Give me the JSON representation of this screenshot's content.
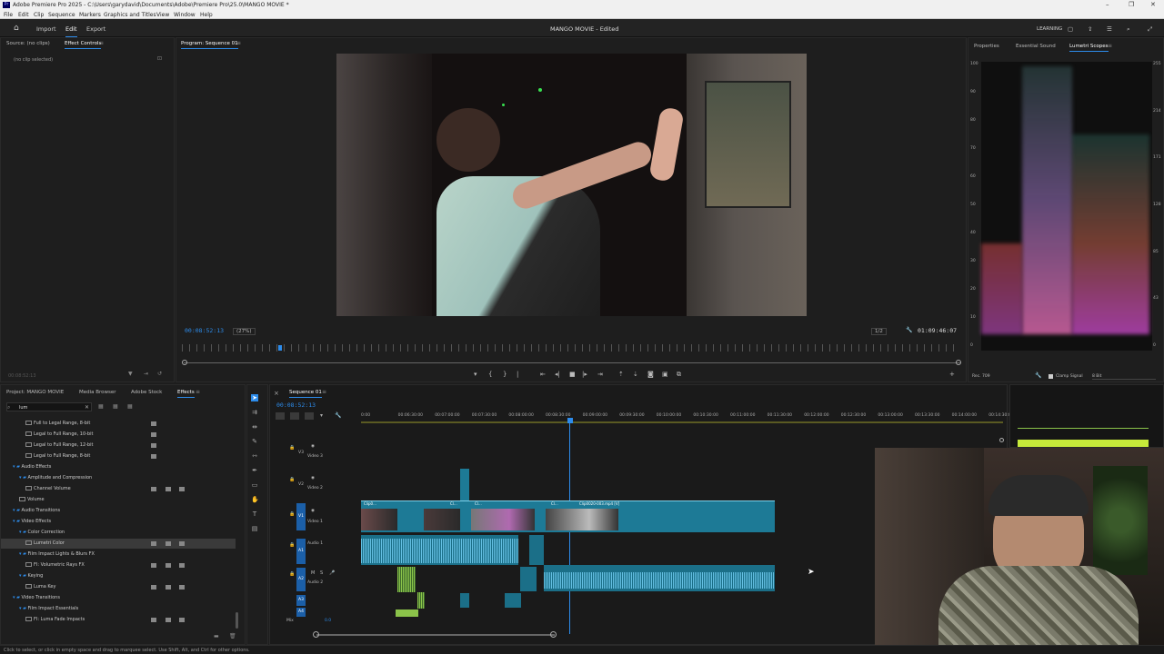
{
  "titlebar": {
    "title": "Adobe Premiere Pro 2025 - C:\\Users\\garydavid\\Documents\\Adobe\\Premiere Pro\\25.0\\MANGO MOVIE *"
  },
  "menu": [
    "File",
    "Edit",
    "Clip",
    "Sequence",
    "Markers",
    "Graphics and Titles",
    "View",
    "Window",
    "Help"
  ],
  "header": {
    "workspaces": [
      "Import",
      "Edit",
      "Export"
    ],
    "active": "Edit",
    "project_title": "MANGO MOVIE - Edited",
    "learning": "LEARNING"
  },
  "source_panel": {
    "tabs": [
      "Source: (no clips)",
      "Effect Controls"
    ],
    "active": "Effect Controls",
    "empty": "(no clip selected)",
    "timecode": "00:08:52:13"
  },
  "program": {
    "tab": "Program: Sequence 01",
    "timecode": "00:08:52:13",
    "zoom": "(27%)",
    "resolution": "1/2",
    "duration": "01:09:46:07",
    "playhead_fraction": 0.1
  },
  "scopes": {
    "tabs": [
      "Properties",
      "Essential Sound",
      "Lumetri Scopes"
    ],
    "active": "Lumetri Scopes",
    "left_scale": [
      "100",
      "90",
      "80",
      "70",
      "60",
      "50",
      "40",
      "30",
      "20",
      "10",
      "0"
    ],
    "right_scale": [
      "255",
      "214",
      "171",
      "128",
      "85",
      "43",
      "0"
    ],
    "colorspace": "Rec. 709",
    "clamp": "Clamp Signal",
    "bitdepth": "8 Bit"
  },
  "project_panel": {
    "tabs": [
      "Project: MANGO MOVIE",
      "Media Browser",
      "Adobe Stock",
      "Effects"
    ],
    "active": "Effects",
    "search": "lum",
    "tree": [
      {
        "label": "Full to Legal Range, 8-bit",
        "depth": 3,
        "type": "effect"
      },
      {
        "label": "Legal to Full Range, 10-bit",
        "depth": 3,
        "type": "effect"
      },
      {
        "label": "Legal to Full Range, 12-bit",
        "depth": 3,
        "type": "effect"
      },
      {
        "label": "Legal to Full Range, 8-bit",
        "depth": 3,
        "type": "effect"
      },
      {
        "label": "Audio Effects",
        "depth": 1,
        "type": "folder"
      },
      {
        "label": "Amplitude and Compression",
        "depth": 2,
        "type": "folder"
      },
      {
        "label": "Channel Volume",
        "depth": 3,
        "type": "effect"
      },
      {
        "label": "Volume",
        "depth": 2,
        "type": "effect"
      },
      {
        "label": "Audio Transitions",
        "depth": 1,
        "type": "folder"
      },
      {
        "label": "Video Effects",
        "depth": 1,
        "type": "folder"
      },
      {
        "label": "Color Correction",
        "depth": 2,
        "type": "folder"
      },
      {
        "label": "Lumetri Color",
        "depth": 3,
        "type": "effect",
        "selected": true
      },
      {
        "label": "Film Impact Lights & Blurs FX",
        "depth": 2,
        "type": "folder"
      },
      {
        "label": "FI: Volumetric Rays FX",
        "depth": 3,
        "type": "effect"
      },
      {
        "label": "Keying",
        "depth": 2,
        "type": "folder"
      },
      {
        "label": "Luma Key",
        "depth": 3,
        "type": "effect"
      },
      {
        "label": "Video Transitions",
        "depth": 1,
        "type": "folder"
      },
      {
        "label": "Film Impact Essentials",
        "depth": 2,
        "type": "folder"
      },
      {
        "label": "FI: Luma Fade Impacts",
        "depth": 3,
        "type": "effect"
      }
    ]
  },
  "timeline": {
    "tab": "Sequence 01",
    "timecode": "00:08:52:13",
    "ruler": [
      "0:00",
      "00:06:30:00",
      "00:07:00:00",
      "00:07:30:00",
      "00:08:00:00",
      "00:08:30:00",
      "00:09:00:00",
      "00:09:30:00",
      "00:10:00:00",
      "00:10:30:00",
      "00:11:00:00",
      "00:11:30:00",
      "00:12:00:00",
      "00:12:30:00",
      "00:13:00:00",
      "00:13:30:00",
      "00:14:00:00",
      "00:14:30:00"
    ],
    "tracks": [
      {
        "id": "V3",
        "name": "Video 3"
      },
      {
        "id": "V2",
        "name": "Video 2"
      },
      {
        "id": "V1",
        "name": "Video 1"
      },
      {
        "id": "A1",
        "name": "Audio 1"
      },
      {
        "id": "A2",
        "name": "Audio 2"
      },
      {
        "id": "A3",
        "name": ""
      },
      {
        "id": "A4",
        "name": ""
      },
      {
        "id": "Mix",
        "name": "0.0"
      }
    ],
    "clip_labels": [
      "Clip0...",
      "Cl...",
      "Cl...",
      "Cl...",
      "Clip0020-003.mp4 [V]"
    ]
  },
  "status": "Click to select, or click in empty space and drag to marquee select. Use Shift, Alt, and Ctrl for other options.",
  "colors": {
    "accent": "#2d8ceb",
    "video_clip": "#1d7a96",
    "audio_clip": "#1b6f88",
    "green": "#8bc34a"
  }
}
